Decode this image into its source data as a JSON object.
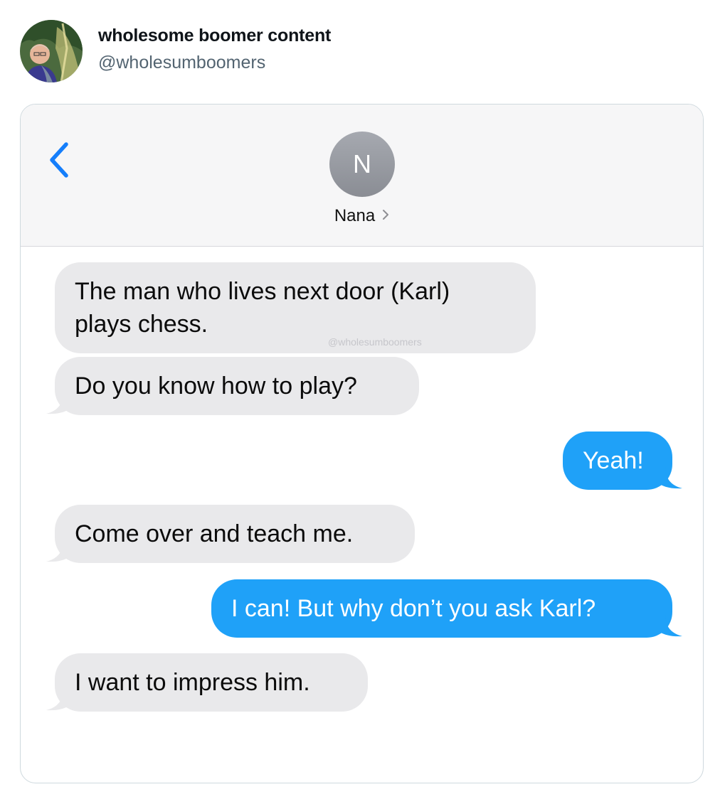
{
  "tweet": {
    "author_name": "wholesome boomer content",
    "author_handle": "@wholesumboomers"
  },
  "conversation": {
    "contact_initial": "N",
    "contact_name": "Nana",
    "watermark": "@wholesumboomers",
    "messages": [
      {
        "direction": "received",
        "text_lines": [
          "The man who lives next door (Karl)",
          "plays chess."
        ]
      },
      {
        "direction": "received",
        "text": "Do you know how to play?"
      },
      {
        "direction": "sent",
        "text": "Yeah!"
      },
      {
        "direction": "received",
        "text": "Come over and teach me."
      },
      {
        "direction": "sent",
        "text": "I can! But why don’t you ask Karl?"
      },
      {
        "direction": "received",
        "text": "I want to impress him."
      }
    ]
  },
  "colors": {
    "sent_bubble": "#1fa1f8",
    "received_bubble": "#e9e9eb",
    "ios_accent": "#157efb"
  },
  "icons": {
    "back": "chevron-left-icon",
    "contact_detail": "chevron-right-icon"
  }
}
